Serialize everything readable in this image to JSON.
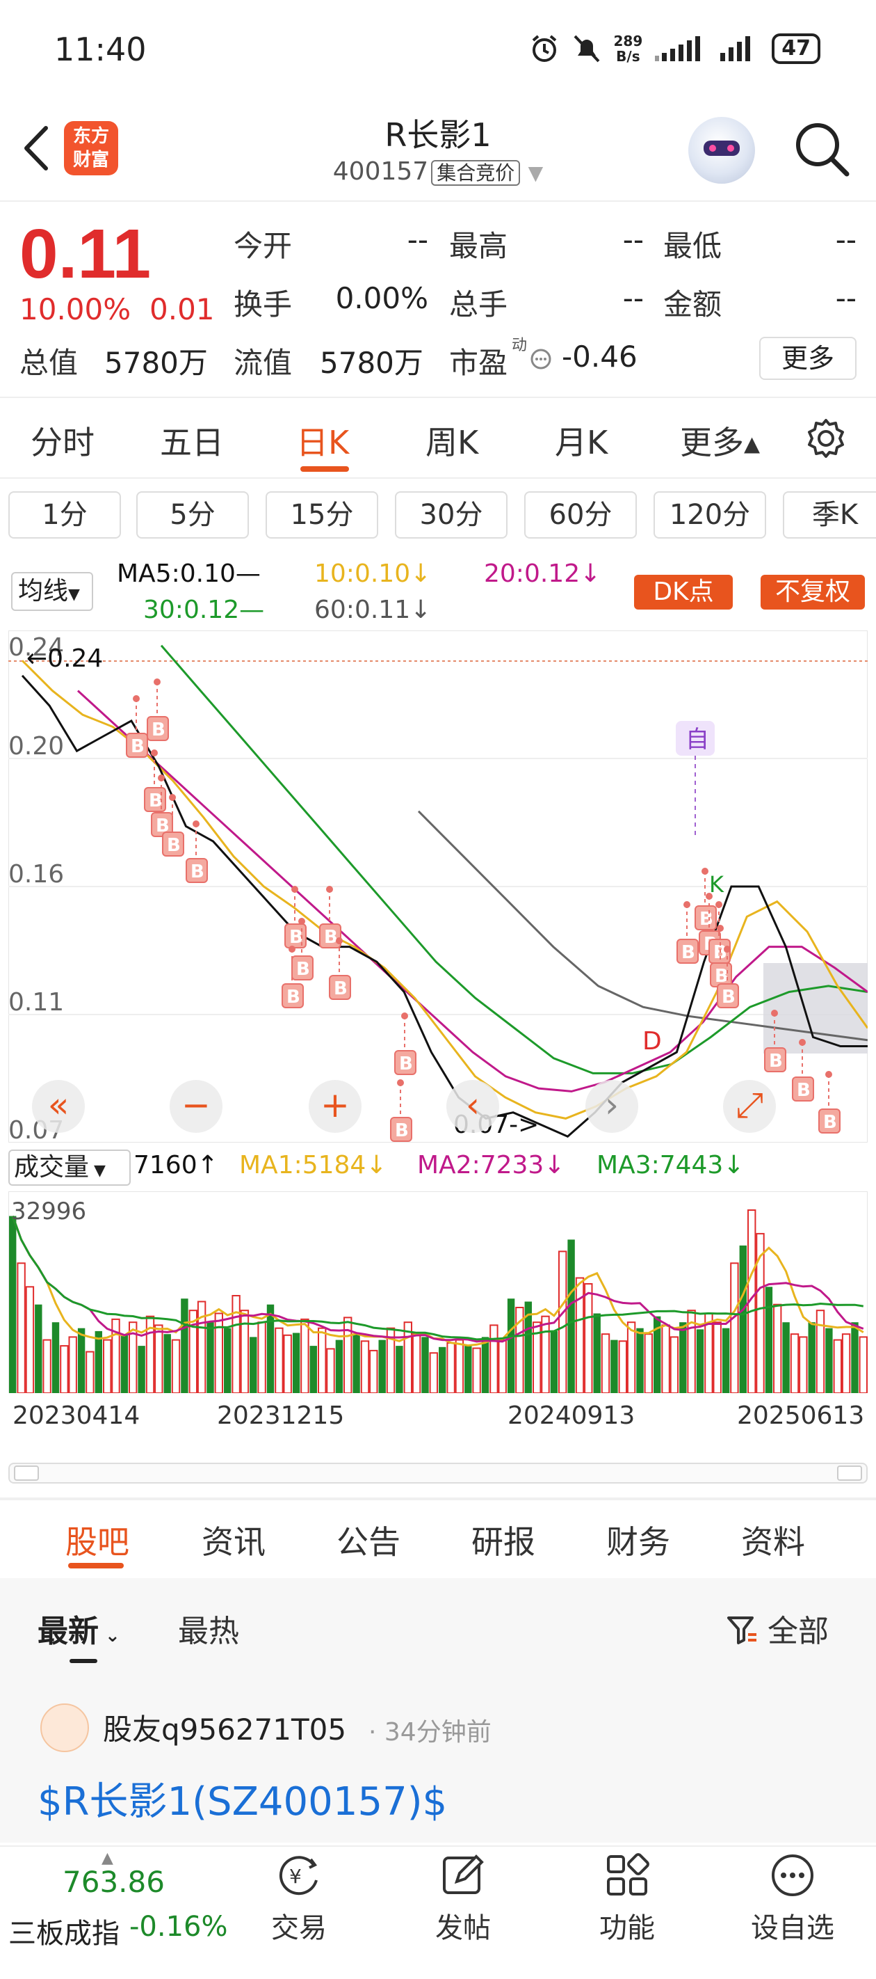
{
  "status_bar": {
    "time": "11:40",
    "net_speed_value": "289",
    "net_speed_unit": "B/s",
    "battery": "47"
  },
  "header": {
    "logo_text_line1": "东方",
    "logo_text_line2": "财富",
    "title": "R长影1",
    "code": "400157",
    "auction_tag": "集合竞价"
  },
  "quote": {
    "price": "0.11",
    "change_pct": "10.00%",
    "change": "0.01",
    "rows": [
      [
        {
          "label": "今开",
          "value": "--"
        },
        {
          "label": "最高",
          "value": "--"
        },
        {
          "label": "最低",
          "value": "--"
        }
      ],
      [
        {
          "label": "换手",
          "value": "0.00%"
        },
        {
          "label": "总手",
          "value": "--"
        },
        {
          "label": "金额",
          "value": "--"
        }
      ]
    ],
    "total_value_label": "总值",
    "total_value": "5780万",
    "float_value_label": "流值",
    "float_value": "5780万",
    "pe_label": "市盈",
    "pe_sup": "动",
    "pe_value": "-0.46",
    "more_button": "更多"
  },
  "period_tabs": [
    "分时",
    "五日",
    "日K",
    "周K",
    "月K",
    "更多▴"
  ],
  "active_period": "日K",
  "minute_buttons": [
    "1分",
    "5分",
    "15分",
    "30分",
    "60分",
    "120分",
    "季K"
  ],
  "ma_legend": {
    "selector": "均线",
    "ma5": "MA5:0.10—",
    "ma10": "10:0.10↓",
    "ma20": "20:0.12↓",
    "ma30": "30:0.12—",
    "ma60": "60:0.11↓",
    "dk_button": "DK点",
    "adjust_button": "不复权"
  },
  "colors": {
    "accent": "#e8541e",
    "up_red": "#e02c2c",
    "down_green": "#1d8a2a",
    "ma5": "#111111",
    "ma10": "#e8b41e",
    "ma20": "#c0198a",
    "ma30": "#1d9a2a",
    "ma60": "#666666",
    "link_blue": "#1a6fd6"
  },
  "chart_data": {
    "type": "line",
    "y_tick_labels": [
      "0.24",
      "0.20",
      "0.16",
      "0.11",
      "0.07"
    ],
    "annotations": [
      "←0.24",
      "0.07->",
      "自",
      "B",
      "D",
      "K"
    ],
    "ylim": [
      0.07,
      0.24
    ],
    "ma5": [
      0.225,
      0.215,
      0.2,
      0.205,
      0.21,
      0.195,
      0.175,
      0.17,
      0.16,
      0.15,
      0.14,
      0.135,
      0.135,
      0.13,
      0.12,
      0.1,
      0.085,
      0.078,
      0.08,
      0.076,
      0.072,
      0.08,
      0.09,
      0.095,
      0.1,
      0.13,
      0.155,
      0.155,
      0.135,
      0.105,
      0.102,
      0.102
    ],
    "ma10": [
      0.23,
      0.22,
      0.212,
      0.208,
      0.2,
      0.19,
      0.178,
      0.165,
      0.155,
      0.148,
      0.14,
      0.135,
      0.128,
      0.118,
      0.105,
      0.092,
      0.085,
      0.08,
      0.078,
      0.082,
      0.088,
      0.092,
      0.1,
      0.12,
      0.145,
      0.15,
      0.14,
      0.122,
      0.108
    ],
    "ma20": [
      0.22,
      0.21,
      0.2,
      0.19,
      0.18,
      0.17,
      0.16,
      0.15,
      0.14,
      0.13,
      0.12,
      0.11,
      0.1,
      0.092,
      0.088,
      0.087,
      0.09,
      0.095,
      0.1,
      0.11,
      0.125,
      0.135,
      0.135,
      0.128,
      0.12
    ],
    "ma30": [
      0.235,
      0.22,
      0.205,
      0.19,
      0.175,
      0.16,
      0.145,
      0.13,
      0.118,
      0.108,
      0.098,
      0.093,
      0.093,
      0.096,
      0.105,
      0.115,
      0.12,
      0.122,
      0.12
    ],
    "ma60": [
      0.18,
      0.165,
      0.15,
      0.135,
      0.122,
      0.115,
      0.112,
      0.11,
      0.108,
      0.106,
      0.104
    ],
    "volume_legend": {
      "selector": "成交量",
      "current": "7160↑",
      "ma1": "MA1:5184↓",
      "ma2": "MA2:7233↓",
      "ma3": "MA3:7443↓",
      "max_label": "32996"
    },
    "volume": [
      30000,
      22000,
      18000,
      15000,
      9000,
      12000,
      8000,
      9500,
      11000,
      7000,
      10500,
      9000,
      12500,
      9800,
      12000,
      8000,
      13000,
      11500,
      10000,
      9000,
      16000,
      14000,
      15500,
      12000,
      13500,
      11000,
      16500,
      14000,
      9500,
      12000,
      15000,
      11000,
      9800,
      10200,
      12500,
      8000,
      11000,
      7500,
      9000,
      12800,
      10000,
      8800,
      7200,
      9000,
      11000,
      8000,
      12000,
      10000,
      9500,
      6800,
      7800,
      8500,
      9000,
      8200,
      7600,
      9500,
      11500,
      9000,
      16000,
      14500,
      15500,
      12000,
      13000,
      10500,
      24000,
      26000,
      19500,
      18500,
      13500,
      10000,
      9000,
      8800,
      12000,
      11000,
      10000,
      13000,
      11500,
      9500,
      12000,
      14000,
      10800,
      13500,
      12000,
      11000,
      22000,
      25000,
      31000,
      27000,
      18000,
      15000,
      12000,
      10000,
      9500,
      12000,
      14000,
      11000,
      9000,
      10000,
      12000,
      9500
    ],
    "x_tick_labels": [
      "20230414",
      "20231215",
      "20240913",
      "20250613"
    ]
  },
  "bottom_tabs": [
    "股吧",
    "资讯",
    "公告",
    "研报",
    "财务",
    "资料"
  ],
  "active_bottom_tab": "股吧",
  "feed": {
    "sort_latest": "最新",
    "sort_hot": "最热",
    "filter_label": "全部",
    "post": {
      "author": "股友q956271T05",
      "time": "34分钟前",
      "content": "$R长影1(SZ400157)$"
    }
  },
  "bottom_nav": {
    "index_value": "763.86",
    "index_name": "三板成指",
    "index_change": "-0.16%",
    "items": [
      "交易",
      "发帖",
      "功能",
      "设自选"
    ]
  }
}
